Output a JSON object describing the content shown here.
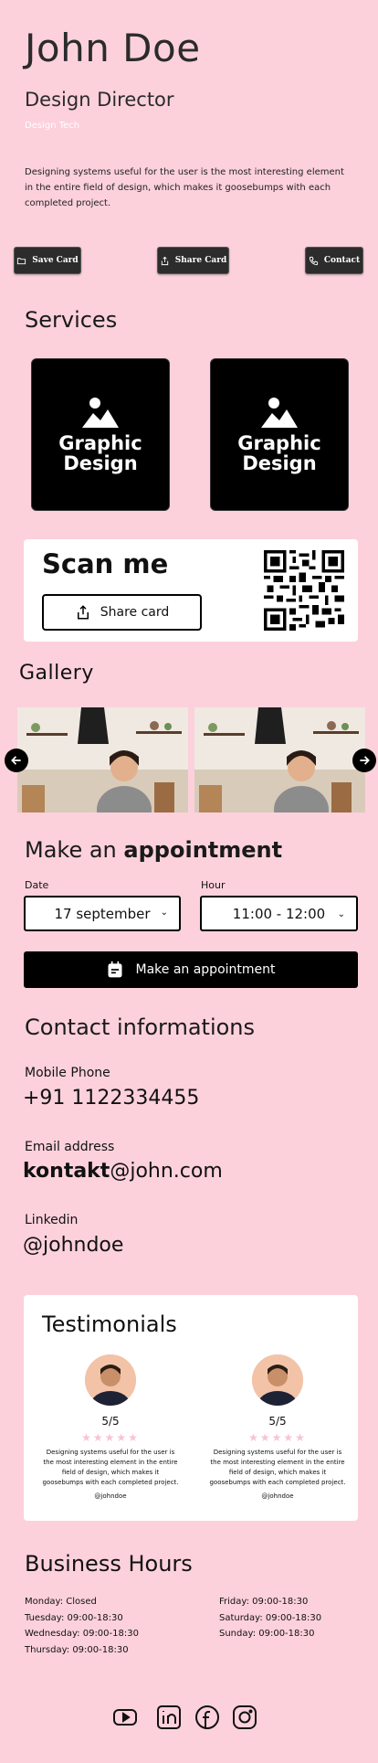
{
  "profile": {
    "name": "John Doe",
    "title": "Design Director",
    "company": "Design Tech",
    "bio": "Designing systems useful for the user is the most interesting element in the entire field of design, which makes it goosebumps with each completed project."
  },
  "actions": {
    "save": "Save Card",
    "share": "Share Card",
    "contact": "Contact"
  },
  "services": {
    "title": "Services",
    "items": [
      {
        "label": "Graphic Design",
        "icon": "image-icon"
      },
      {
        "label": "Graphic Design",
        "icon": "image-icon"
      }
    ]
  },
  "scan": {
    "title": "Scan me",
    "share_label": "Share card"
  },
  "gallery": {
    "title": "Gallery"
  },
  "appointment": {
    "title_prefix": "Make an",
    "title_bold": "appointment",
    "date_label": "Date",
    "date_value": "17 september",
    "hour_label": "Hour",
    "hour_value": "11:00 - 12:00",
    "button": "Make an appointment"
  },
  "contact": {
    "title": "Contact informations",
    "phone_label": "Mobile Phone",
    "phone": "+91 1122334455",
    "email_label": "Email address",
    "email_bold": "kontakt",
    "email_rest": "@john.com",
    "linkedin_label": "Linkedin",
    "linkedin": "@johndoe"
  },
  "testimonials": {
    "title": "Testimonials",
    "items": [
      {
        "rating": "5/5",
        "stars": "★★★★★",
        "text": "Designing systems useful for the user is the most interesting element in the entire field of design, which makes it goosebumps with each completed project.",
        "handle": "@johndoe"
      },
      {
        "rating": "5/5",
        "stars": "★★★★★",
        "text": "Designing systems useful for the user is the most interesting element in the entire field of design, which makes it goosebumps with each completed project.",
        "handle": "@johndoe"
      }
    ]
  },
  "hours": {
    "title": "Business Hours",
    "left": [
      "Monday: Closed",
      "Tuesday: 09:00-18:30",
      "Wednesday: 09:00-18:30",
      "Thursday: 09:00-18:30"
    ],
    "right": [
      "Friday: 09:00-18:30",
      "Saturday: 09:00-18:30",
      "Sunday: 09:00-18:30"
    ]
  },
  "social": [
    "youtube-icon",
    "linkedin-icon",
    "facebook-icon",
    "instagram-icon"
  ],
  "colors": {
    "background": "#fcd1dc",
    "dark": "#000000",
    "star": "#f7c4d2"
  }
}
